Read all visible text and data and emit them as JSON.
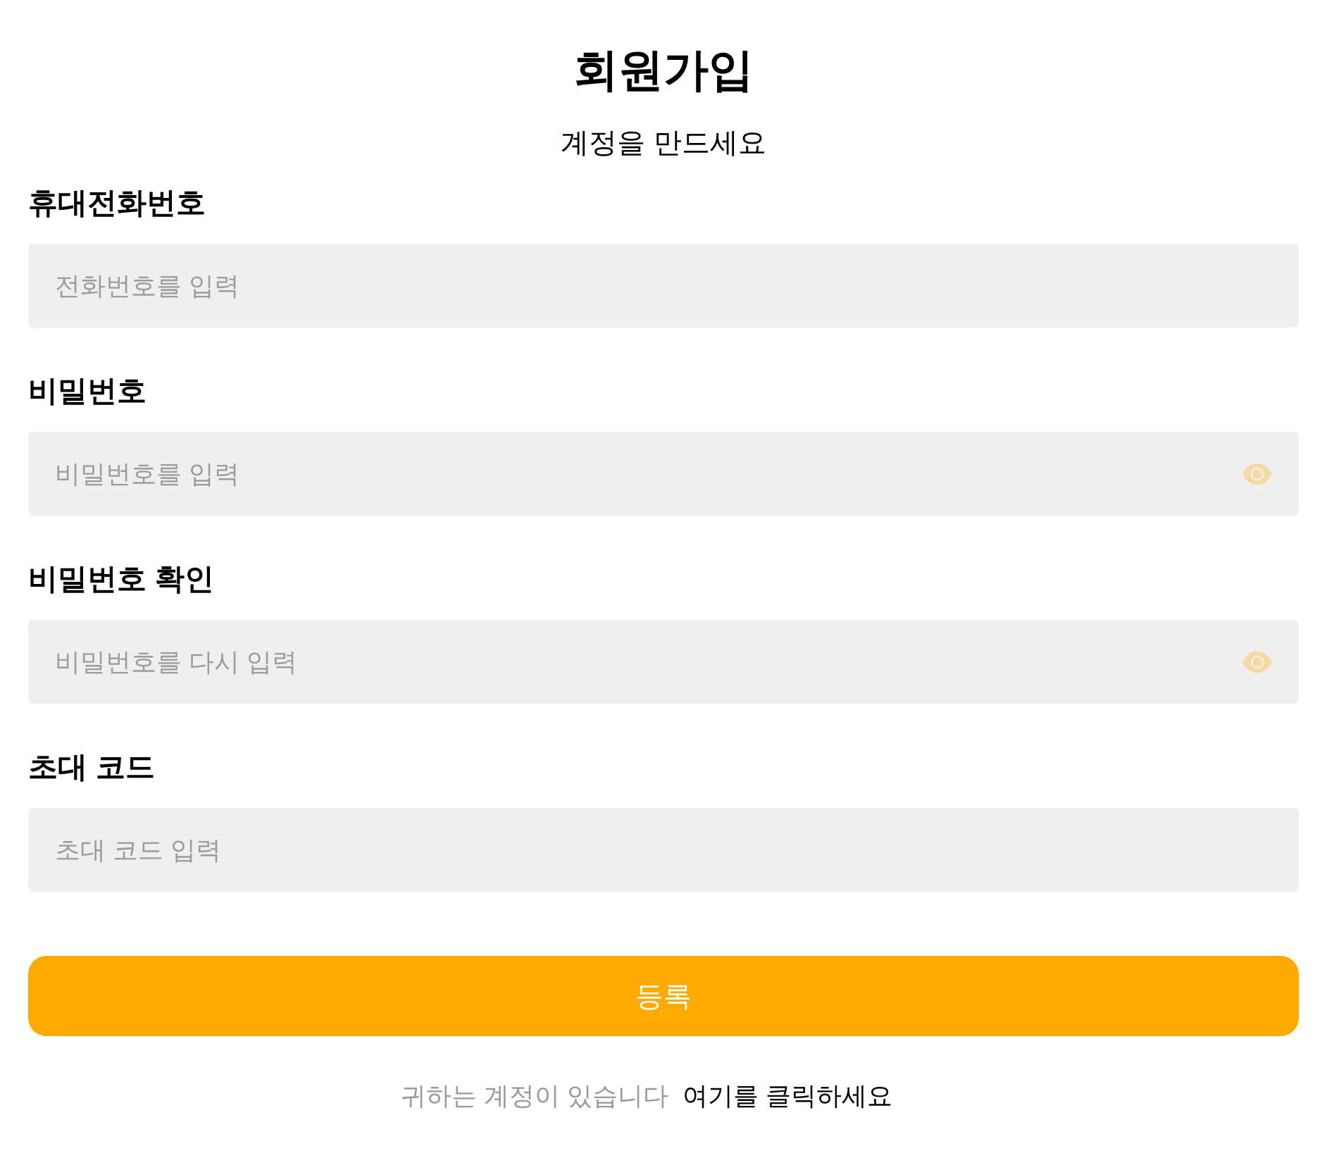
{
  "title": "회원가입",
  "subtitle": "계정을 만드세요",
  "fields": [
    {
      "kind": "text",
      "label": "휴대전화번호",
      "placeholder": "전화번호를 입력"
    },
    {
      "kind": "password",
      "label": "비밀번호",
      "placeholder": "비밀번호를 입력"
    },
    {
      "kind": "password",
      "label": "비밀번호 확인",
      "placeholder": "비밀번호를 다시 입력"
    },
    {
      "kind": "text",
      "label": "초대 코드",
      "placeholder": "초대 코드 입력"
    }
  ],
  "submit_button": {
    "label": "등록"
  },
  "footer": {
    "prompt": "귀하는 계정이 있습니다",
    "link": "여기를 클릭하세요"
  }
}
